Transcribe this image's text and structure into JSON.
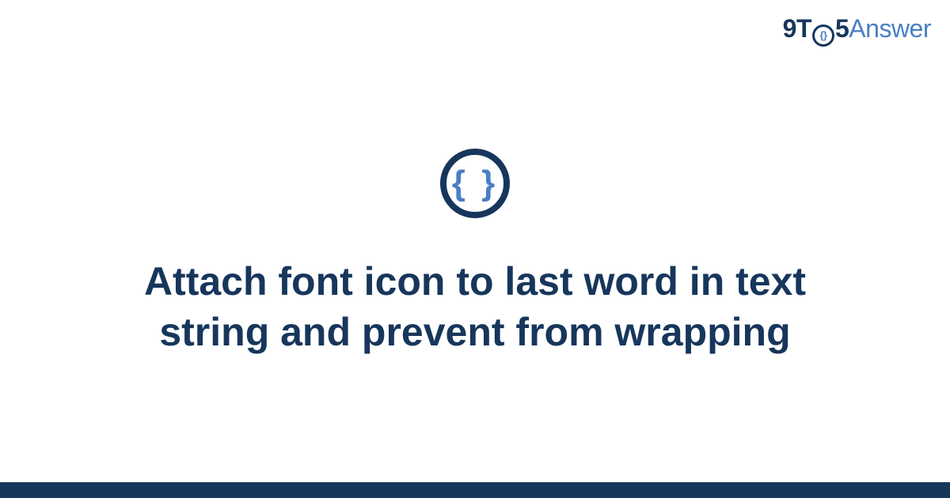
{
  "brand": {
    "part1": "9T",
    "inner_icon": "{}",
    "part2": "5",
    "part3": "Answer"
  },
  "category_icon_glyph": "{ }",
  "title": "Attach font icon to last word in text string and prevent from wrapping",
  "colors": {
    "primary_dark": "#17365c",
    "accent_blue": "#4a7fc4"
  }
}
